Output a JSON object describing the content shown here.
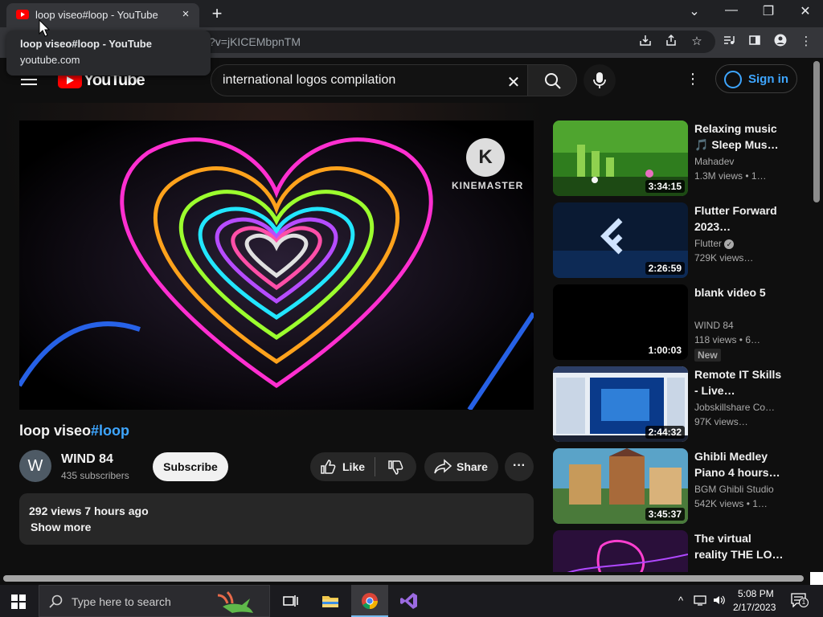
{
  "browser": {
    "tab_title": "loop viseo#loop - YouTube",
    "tab_close": "×",
    "new_tab": "+",
    "url_tail": "?v=jKICEMbpnTM",
    "tooltip_title": "loop viseo#loop - YouTube",
    "tooltip_domain": "youtube.com",
    "window_controls": {
      "dropdown": "⌄",
      "minimize": "—",
      "restore": "❐",
      "close": "✕"
    },
    "toolbar_icons": [
      "download-icon",
      "share-icon",
      "star-icon",
      "media-icon",
      "sidebar-icon",
      "profile-icon",
      "menu-icon"
    ]
  },
  "masthead": {
    "logo_text": "YouTube",
    "search_value": "international logos compilation",
    "search_placeholder": "Search",
    "clear": "✕",
    "more": "⋮",
    "signin": "Sign in"
  },
  "player": {
    "watermark_letter": "K",
    "watermark_text": "KINEMASTER"
  },
  "video": {
    "title_main": "loop viseo",
    "title_tag": "#loop",
    "channel_initial": "W",
    "channel_name": "WIND 84",
    "subscribers": "435 subscribers",
    "subscribe": "Subscribe",
    "like": "Like",
    "share": "Share",
    "more": "···",
    "views_time": "292 views  7 hours ago",
    "show_more": "Show more"
  },
  "recommendations": [
    {
      "title": "Relaxing music 🎵 Sleep Mus…",
      "channel": "Mahadev",
      "meta": "1.3M views  • 1…",
      "duration": "3:34:15",
      "badge": ""
    },
    {
      "title": "Flutter Forward 2023…",
      "channel": "Flutter",
      "meta": "729K views…",
      "duration": "2:26:59",
      "badge": ""
    },
    {
      "title": "blank video 5",
      "channel": "WIND 84",
      "meta": "118 views  • 6…",
      "duration": "1:00:03",
      "badge": "New"
    },
    {
      "title": "Remote IT Skills - Live…",
      "channel": "Jobskillshare Co…",
      "meta": "97K views…",
      "duration": "2:44:32",
      "badge": ""
    },
    {
      "title": "Ghibli Medley Piano 4 hours…",
      "channel": "BGM Ghibli Studio",
      "meta": "542K views  • 1…",
      "duration": "3:45:37",
      "badge": ""
    },
    {
      "title": "The virtual reality THE LO…",
      "channel": "",
      "meta": "",
      "duration": "",
      "badge": ""
    }
  ],
  "taskbar": {
    "search_placeholder": "Type here to search",
    "time": "5:08 PM",
    "date": "2/17/2023",
    "notification_count": "1"
  },
  "colors": {
    "accent_blue": "#3ea6ff",
    "youtube_red": "#ff0000",
    "background": "#0f0f0f"
  }
}
